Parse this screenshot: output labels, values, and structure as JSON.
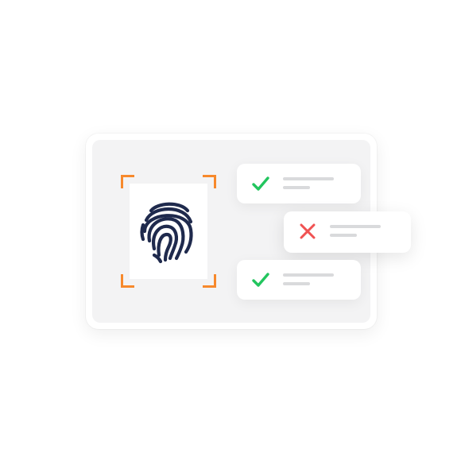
{
  "illustration": {
    "scanner": {
      "corner_color": "#f7892c",
      "fingerprint_icon": "fingerprint-icon",
      "fingerprint_color": "#1f2a4d"
    },
    "results": [
      {
        "status": "pass",
        "icon": "check-icon",
        "color": "#22c55e"
      },
      {
        "status": "fail",
        "icon": "close-icon",
        "color": "#f05252"
      },
      {
        "status": "pass",
        "icon": "check-icon",
        "color": "#22c55e"
      }
    ]
  }
}
